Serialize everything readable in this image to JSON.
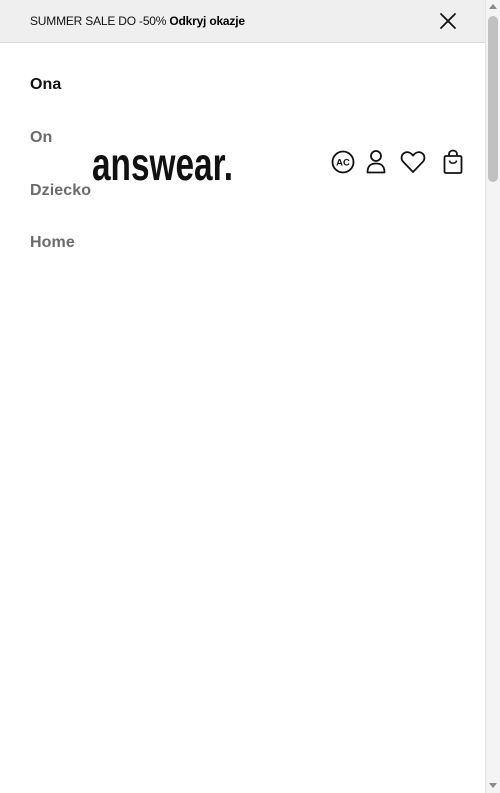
{
  "promo": {
    "text": "SUMMER SALE DO -50%",
    "link": "Odkryj okazje",
    "close_icon": "close-icon"
  },
  "brand": {
    "logo_text": "answear."
  },
  "header_icons": {
    "accessibility_label": "AC",
    "user_icon": "user-icon",
    "heart_icon": "heart-icon",
    "bag_icon": "shopping-bag-icon"
  },
  "menu": {
    "items": [
      {
        "label": "Ona",
        "active": true
      },
      {
        "label": "On",
        "active": false
      },
      {
        "label": "Dziecko",
        "active": false
      },
      {
        "label": "Home",
        "active": false
      }
    ]
  },
  "colors": {
    "promo_bg": "#efefef",
    "text_primary": "#111111",
    "text_secondary": "#6b6b6b"
  }
}
